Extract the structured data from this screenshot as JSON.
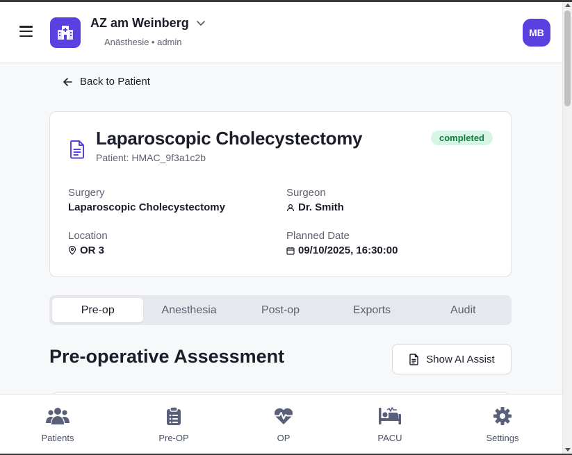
{
  "header": {
    "hospital_name": "AZ am Weinberg",
    "subtitle": "Anästhesie • admin",
    "avatar_initials": "MB",
    "accent_color": "#5b3fe0"
  },
  "back_link": {
    "label": "Back to Patient"
  },
  "surgery": {
    "title": "Laparoscopic Cholecystectomy",
    "patient": "Patient: HMAC_9f3a1c2b",
    "status": "completed",
    "fields": {
      "surgery_label": "Surgery",
      "surgery_value": "Laparoscopic Cholecystectomy",
      "surgeon_label": "Surgeon",
      "surgeon_value": "Dr. Smith",
      "location_label": "Location",
      "location_value": "OR 3",
      "planned_date_label": "Planned Date",
      "planned_date_value": "09/10/2025, 16:30:00"
    }
  },
  "tabs": [
    {
      "label": "Pre-op",
      "active": true
    },
    {
      "label": "Anesthesia",
      "active": false
    },
    {
      "label": "Post-op",
      "active": false
    },
    {
      "label": "Exports",
      "active": false
    },
    {
      "label": "Audit",
      "active": false
    }
  ],
  "section": {
    "title": "Pre-operative Assessment",
    "ai_button_label": "Show AI Assist"
  },
  "bottom_nav": [
    {
      "label": "Patients",
      "icon": "users-icon"
    },
    {
      "label": "Pre-OP",
      "icon": "clipboard-icon"
    },
    {
      "label": "OP",
      "icon": "heartbeat-icon"
    },
    {
      "label": "PACU",
      "icon": "bed-icon"
    },
    {
      "label": "Settings",
      "icon": "gear-icon"
    }
  ]
}
